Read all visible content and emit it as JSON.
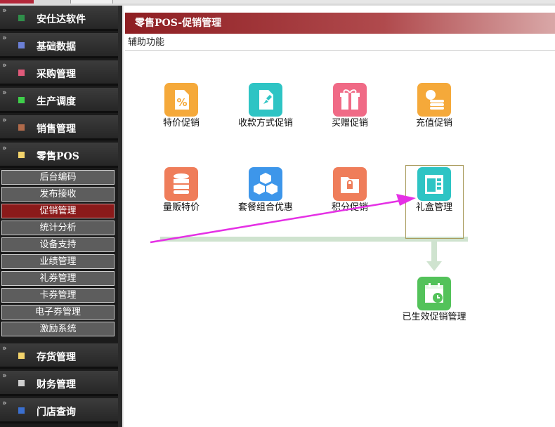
{
  "sidebar": {
    "categories": [
      {
        "label": "安仕达软件",
        "color": "#2f8f4a"
      },
      {
        "label": "基础数据",
        "color": "#6b7fd6"
      },
      {
        "label": "采购管理",
        "color": "#e05a7a"
      },
      {
        "label": "生产调度",
        "color": "#3ecf4a"
      },
      {
        "label": "销售管理",
        "color": "#b06a4a"
      },
      {
        "label": "零售POS",
        "color": "#f2d36b"
      },
      {
        "label": "存货管理",
        "color": "#f2d36b"
      },
      {
        "label": "财务管理",
        "color": "#cfcfcf"
      },
      {
        "label": "门店查询",
        "color": "#3a6fd0"
      }
    ],
    "subitems": [
      "后台编码",
      "发布接收",
      "促销管理",
      "统计分析",
      "设备支持",
      "业绩管理",
      "礼券管理",
      "卡券管理",
      "电子券管理",
      "激励系统"
    ],
    "active_subitem": "促销管理"
  },
  "page": {
    "title": "零售POS-促销管理",
    "toolbar_label": "辅助功能"
  },
  "tiles": [
    {
      "label": "特价促销",
      "icon": "percent-tag-icon",
      "color": "#f5a93a"
    },
    {
      "label": "收款方式促销",
      "icon": "pin-icon",
      "color": "#2ec4c4"
    },
    {
      "label": "买赠促销",
      "icon": "gift-icon",
      "color": "#f06a86"
    },
    {
      "label": "充值促销",
      "icon": "coins-icon",
      "color": "#f5a93a"
    },
    {
      "label": "量贩特价",
      "icon": "database-icon",
      "color": "#ef7d5a"
    },
    {
      "label": "套餐组合优惠",
      "icon": "cubes-icon",
      "color": "#3d96ea"
    },
    {
      "label": "积分促销",
      "icon": "folder-lock-icon",
      "color": "#ef7d5a"
    },
    {
      "label": "礼盒管理",
      "icon": "window-icon",
      "color": "#2ec4c4"
    },
    {
      "label": "已生效促销管理",
      "icon": "calendar-clock-icon",
      "color": "#53c25a"
    }
  ],
  "annotation": {
    "color": "#e530e5"
  }
}
